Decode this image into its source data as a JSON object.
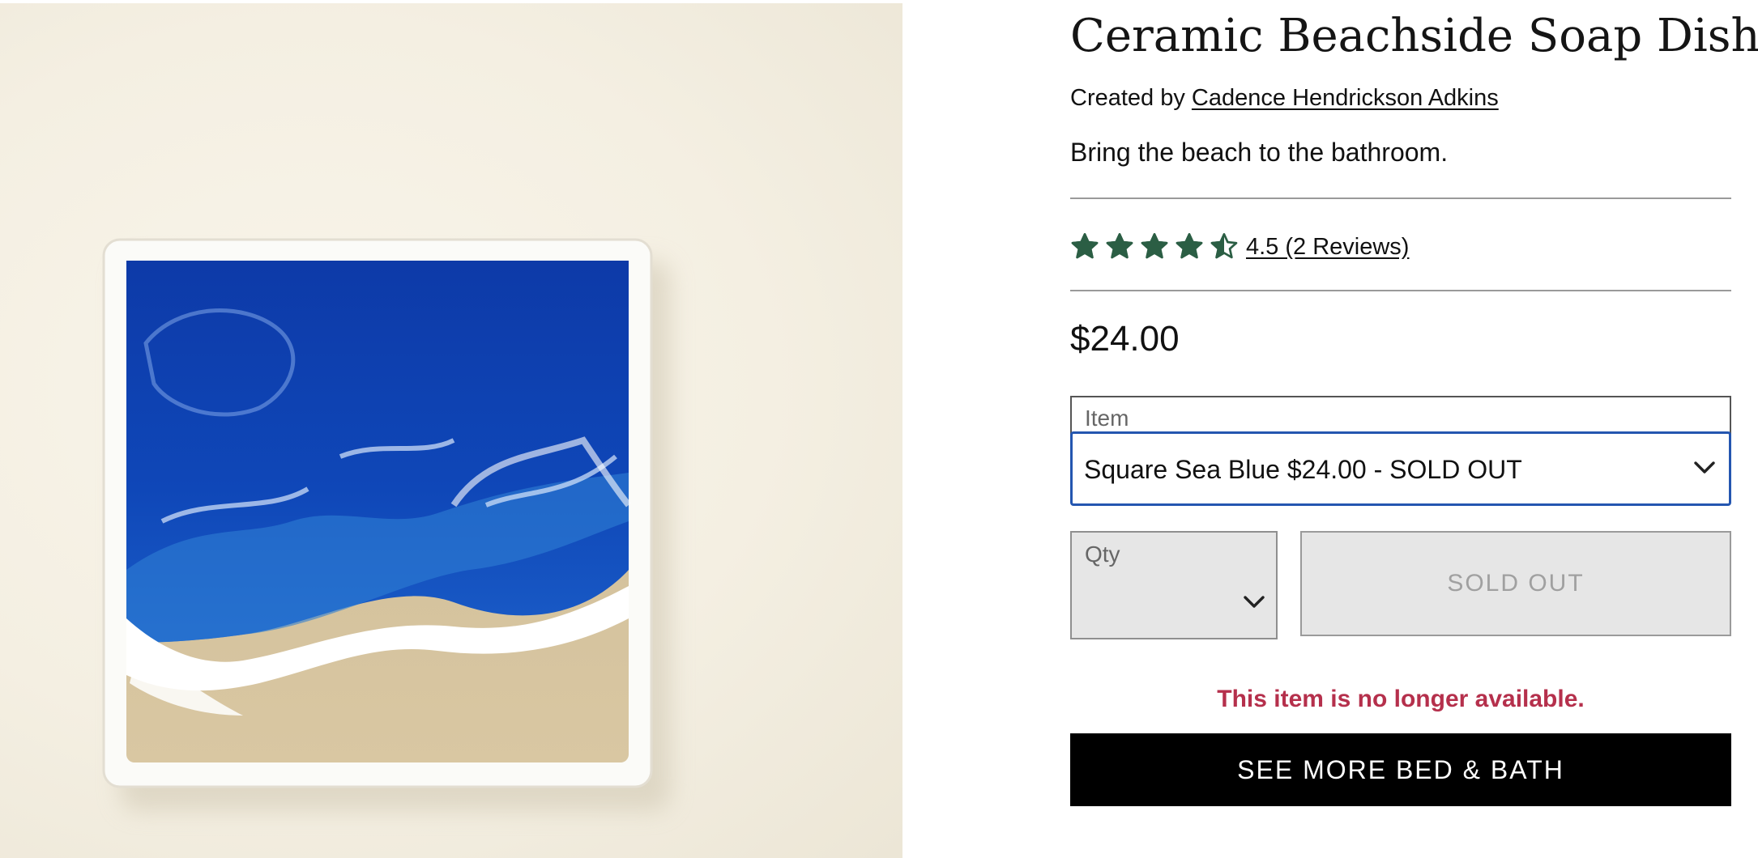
{
  "product": {
    "title": "Ceramic Beachside Soap Dish",
    "creator_prefix": "Created by",
    "creator_name": "Cadence Hendrickson Adkins",
    "tagline": "Bring the beach to the bathroom.",
    "rating": 4.5,
    "rating_text": "4.5 (2 Reviews)",
    "price": "$24.00"
  },
  "item_select": {
    "label": "Item",
    "value": "Square Sea Blue $24.00 - SOLD OUT"
  },
  "qty": {
    "label": "Qty"
  },
  "buttons": {
    "sold_out": "SOLD OUT",
    "see_more": "SEE MORE BED & BATH"
  },
  "messages": {
    "unavailable": "This item is no longer available."
  },
  "colors": {
    "star": "#2b5e44",
    "select_border": "#2456b0",
    "unavailable_text": "#b5304c",
    "cta_background": "#000000"
  },
  "icons": {
    "star": "star-icon",
    "half_star": "half-star-icon",
    "chevron": "chevron-down-icon"
  }
}
